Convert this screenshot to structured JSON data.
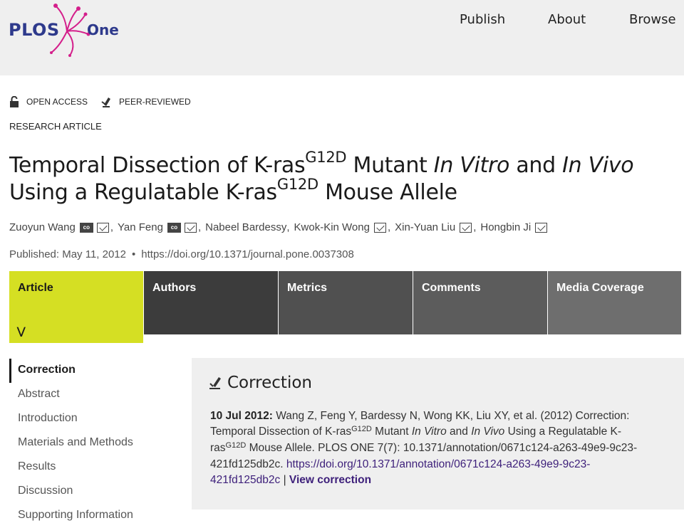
{
  "header": {
    "logo_text": "PLOS",
    "logo_suffix": "One",
    "nav": [
      "Publish",
      "About",
      "Browse"
    ]
  },
  "flags": {
    "open_access": "OPEN ACCESS",
    "peer_reviewed": "PEER-REVIEWED"
  },
  "article_type": "RESEARCH ARTICLE",
  "title": {
    "part1": "Temporal Dissection of K-ras",
    "sup1": "G12D",
    "part2": " Mutant ",
    "em1": "In Vitro",
    "part3": " and ",
    "em2": "In Vivo",
    "part4": " Using a Regulatable K-ras",
    "sup2": "G12D",
    "part5": " Mouse Allele"
  },
  "authors": [
    {
      "name": "Zuoyun Wang",
      "orcid": true
    },
    {
      "name": "Yan Feng",
      "orcid": true
    },
    {
      "name": "Nabeel Bardessy",
      "orcid": false
    },
    {
      "name": "Kwok-Kin Wong",
      "orcid": false
    },
    {
      "name": "Xin-Yuan Liu",
      "orcid": false
    },
    {
      "name": "Hongbin Ji",
      "orcid": false
    }
  ],
  "pubinfo": {
    "published": "Published: May 11, 2012",
    "doi": "https://doi.org/10.1371/journal.pone.0037308"
  },
  "tabs": [
    "Article",
    "Authors",
    "Metrics",
    "Comments",
    "Media Coverage"
  ],
  "toc": [
    "Correction",
    "Abstract",
    "Introduction",
    "Materials and Methods",
    "Results",
    "Discussion",
    "Supporting Information"
  ],
  "correction": {
    "heading": "Correction",
    "date": "10 Jul 2012:",
    "text1": " Wang Z, Feng Y, Bardessy N, Wong KK, Liu XY, et al. (2012) Correction: Temporal Dissection of K-ras",
    "sup1": "G12D",
    "text2": " Mutant ",
    "em1": "In Vitro",
    "text3": " and ",
    "em2": "In Vivo",
    "text4": " Using a Regulatable K-ras",
    "sup2": "G12D",
    "text5": " Mouse Allele. PLOS ONE 7(7): 10.1371/annotation/0671c124-a263-49e9-9c23-421fd125db2c. ",
    "link": "https://doi.org/10.1371/annotation/0671c124-a263-49e9-9c23-421fd125db2c",
    "divider": " | ",
    "view": "View correction"
  },
  "colors": {
    "header_bg": "#efefef",
    "logo_blue": "#2e3a8c",
    "logo_magenta": "#d41f8b",
    "active_tab": "#d5df23",
    "link": "#3d1f7a"
  }
}
